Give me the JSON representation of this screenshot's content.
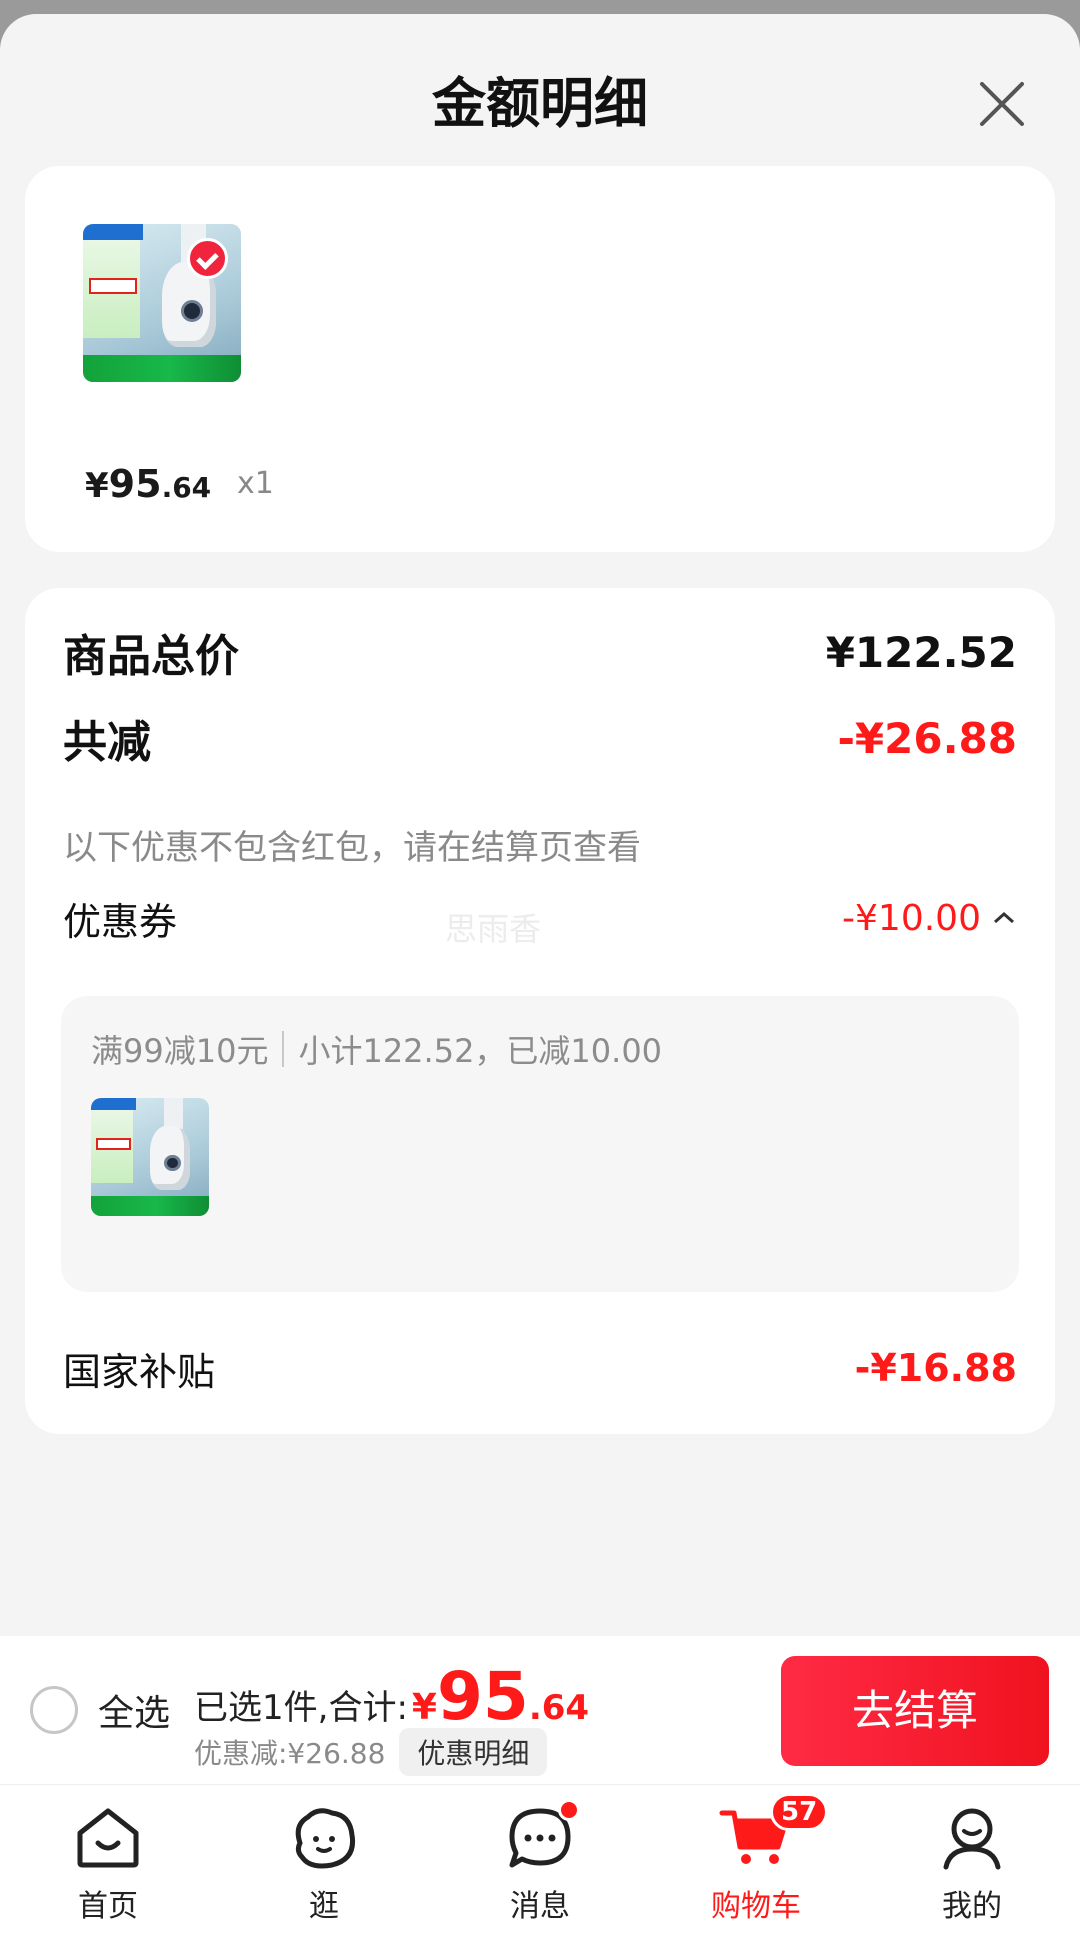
{
  "header": {
    "title": "金额明细"
  },
  "product": {
    "price_yen": "¥",
    "price_int": "95",
    "price_dec": ".64",
    "quantity": "x1"
  },
  "summary": {
    "total_label": "商品总价",
    "total_value": "¥122.52",
    "reduction_label": "共减",
    "reduction_value": "-¥26.88",
    "reduction_note": "以下优惠不包含红包，请在结算页查看",
    "watermark": "思雨香",
    "coupon_label": "优惠券",
    "coupon_value": "-¥10.00",
    "coupon_detail_rule": "满99减10元",
    "coupon_detail_sub": "小计122.52，已减10.00",
    "subsidy_label": "国家补贴",
    "subsidy_value": "-¥16.88"
  },
  "checkout": {
    "select_all": "全选",
    "selected_text": "已选1件,合计:",
    "total_yen": "¥",
    "total_int": "95",
    "total_dec": ".64",
    "discount_text": "优惠减:¥26.88",
    "discount_detail_btn": "优惠明细",
    "checkout_btn": "去结算"
  },
  "tabbar": {
    "items": [
      {
        "label": "首页",
        "icon": "home-icon"
      },
      {
        "label": "逛",
        "icon": "browse-icon"
      },
      {
        "label": "消息",
        "icon": "message-icon"
      },
      {
        "label": "购物车",
        "icon": "cart-icon",
        "badge": "57",
        "active": true
      },
      {
        "label": "我的",
        "icon": "profile-icon"
      }
    ]
  },
  "colors": {
    "accent": "#ff1a1a",
    "background": "#f4f4f4"
  }
}
